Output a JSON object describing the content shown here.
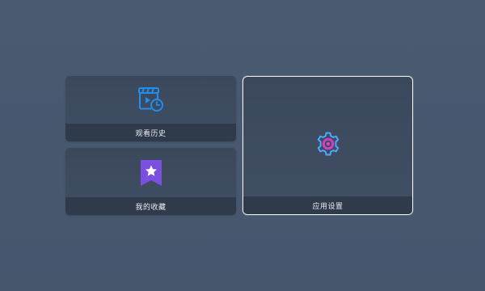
{
  "tiles": {
    "history": {
      "label": "观看历史",
      "icon": "history-clapper-clock-icon"
    },
    "favorites": {
      "label": "我的收藏",
      "icon": "bookmark-star-icon"
    },
    "settings": {
      "label": "应用设置",
      "icon": "gear-icon",
      "focused": true
    }
  },
  "colors": {
    "background": "#48586f",
    "tile": "#3e4b5f",
    "label_bar": "#2f3a4b",
    "focus_border": "#f2f4f7",
    "history_icon": "#1e8ff0",
    "favorites_icon": "#7b4fe0",
    "settings_icon_outer": "#4aa8ff",
    "settings_icon_inner": "#e040c8"
  }
}
